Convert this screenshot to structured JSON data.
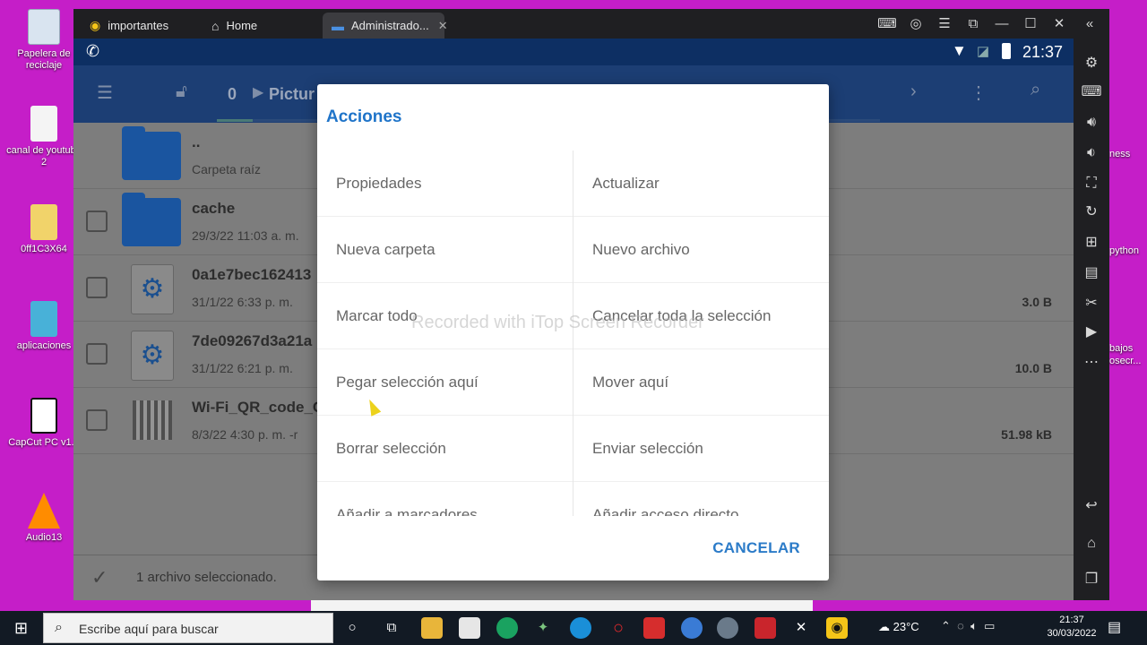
{
  "desktop": {
    "icons": [
      {
        "label": "Papelera de reciclaje",
        "color": "#d9e4f0"
      },
      {
        "label": "canal de youtube 2",
        "color": "#f4f4f4"
      },
      {
        "label": "0ff1C3X64",
        "color": "#f1d36a"
      },
      {
        "label": "aplicaciones",
        "color": "#48b1d8"
      },
      {
        "label": "CapCut PC v1.3",
        "color": "#ffffff"
      },
      {
        "label": "Audio13",
        "color": "#ff8c00"
      }
    ],
    "right_labels": [
      "ness",
      "python",
      "bajos",
      "osecr..."
    ]
  },
  "emulator": {
    "tabs": [
      {
        "label": "importantes",
        "icon": "logo-icon"
      },
      {
        "label": "Home",
        "icon": "home-icon"
      },
      {
        "label": "Administrado...",
        "icon": "folder-icon"
      }
    ],
    "status_clock": "21:37"
  },
  "app": {
    "path_number": "0",
    "path_name": "Pictur",
    "files": [
      {
        "name": "..",
        "meta": "Carpeta raíz",
        "size": "",
        "type": "folder"
      },
      {
        "name": "cache",
        "meta": "29/3/22 11:03 a. m.",
        "size": "",
        "type": "folder"
      },
      {
        "name": "0a1e7bec162413",
        "meta": "31/1/22 6:33 p. m.",
        "size": "3.0 B",
        "type": "gear"
      },
      {
        "name": "7de09267d3a21a",
        "meta": "31/1/22 6:21 p. m.",
        "size": "10.0 B",
        "type": "gear"
      },
      {
        "name": "Wi-Fi_QR_code_C",
        "meta": "8/3/22 4:30 p. m.  -r",
        "size": "51.98 kB",
        "type": "qr"
      }
    ],
    "selection_status": "1 archivo seleccionado."
  },
  "dialog": {
    "title": "Acciones",
    "options": [
      [
        "Propiedades",
        "Actualizar"
      ],
      [
        "Nueva carpeta",
        "Nuevo archivo"
      ],
      [
        "Marcar todo",
        "Cancelar toda la selección"
      ],
      [
        "Pegar selección aquí",
        "Mover aquí"
      ],
      [
        "Borrar selección",
        "Enviar selección"
      ],
      [
        "Añadir a marcadores",
        "Añadir acceso directo"
      ]
    ],
    "cancel_label": "CANCELAR"
  },
  "watermark": "Recorded with iTop Screen Recorder",
  "taskbar": {
    "search_placeholder": "Escribe aquí para buscar",
    "weather": "23°C",
    "time": "21:37",
    "date": "30/03/2022"
  },
  "colors": {
    "desktop_bg": "#c51ec8",
    "app_bar": "#1c3e74",
    "accent_blue": "#1f74c9"
  }
}
